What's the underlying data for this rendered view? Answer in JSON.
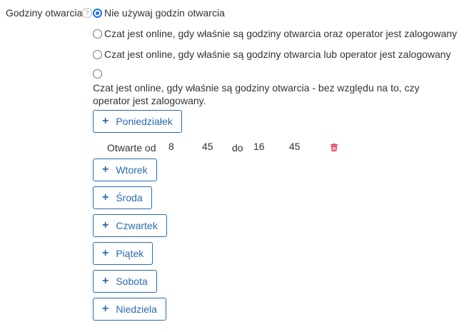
{
  "field": {
    "label": "Godziny otwarcia",
    "help": "?"
  },
  "options": [
    {
      "label": "Nie używaj godzin otwarcia",
      "checked": true
    },
    {
      "label": "Czat jest online, gdy właśnie są godziny otwarcia oraz operator jest zalogowany",
      "checked": false
    },
    {
      "label": "Czat jest online, gdy właśnie są godziny otwarcia lub operator jest zalogowany",
      "checked": false
    },
    {
      "label": "Czat jest online, gdy właśnie są godziny otwarcia - bez względu na to, czy operator jest zalogowany.",
      "checked": false
    }
  ],
  "days": [
    {
      "label": "Poniedziałek"
    },
    {
      "label": "Wtorek"
    },
    {
      "label": "Środa"
    },
    {
      "label": "Czwartek"
    },
    {
      "label": "Piątek"
    },
    {
      "label": "Sobota"
    },
    {
      "label": "Niedziela"
    }
  ],
  "hours": {
    "open_label": "Otwarte od",
    "from_hour": "8",
    "from_minute": "45",
    "to_label": "do",
    "to_hour": "16",
    "to_minute": "45"
  },
  "colors": {
    "accent": "#2a6bb3",
    "radio_checked": "#1a73e8",
    "delete": "#e0405a"
  },
  "icons": {
    "add": "plus-icon",
    "delete": "trash-icon",
    "help": "question-icon"
  }
}
